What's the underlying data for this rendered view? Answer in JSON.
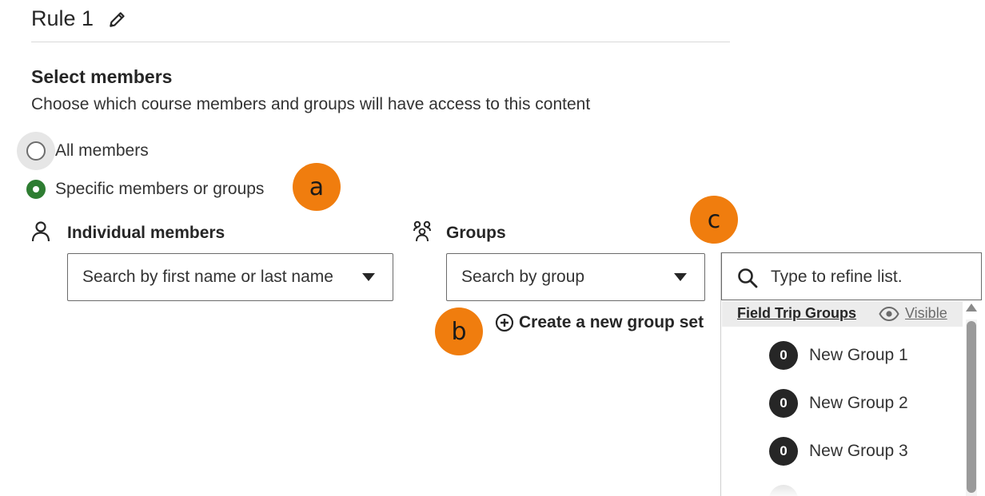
{
  "rule": {
    "title": "Rule 1"
  },
  "section": {
    "title": "Select members",
    "description": "Choose which course members and groups will have access to this content"
  },
  "options": {
    "all_members": "All members",
    "specific": "Specific members or groups",
    "selected": "specific"
  },
  "individual": {
    "label": "Individual members",
    "placeholder": "Search by first name or last name"
  },
  "groups": {
    "label": "Groups",
    "placeholder": "Search by group",
    "create_link": "Create a new group set"
  },
  "dropdown": {
    "search_placeholder": "Type to refine list.",
    "group_set": {
      "name": "Field Trip Groups",
      "visibility": "Visible",
      "items": [
        {
          "count": "0",
          "label": "New Group 1"
        },
        {
          "count": "0",
          "label": "New Group 2"
        },
        {
          "count": "0",
          "label": "New Group 3"
        }
      ]
    }
  },
  "callouts": [
    "a",
    "b",
    "c"
  ],
  "colors": {
    "accent_orange": "#f07d0e",
    "radio_selected": "#2e7d32",
    "badge": "#262626"
  },
  "icons": [
    "edit-icon",
    "person-icon",
    "groups-icon",
    "caret-down-icon",
    "plus-circle-icon",
    "search-icon",
    "eye-icon"
  ]
}
